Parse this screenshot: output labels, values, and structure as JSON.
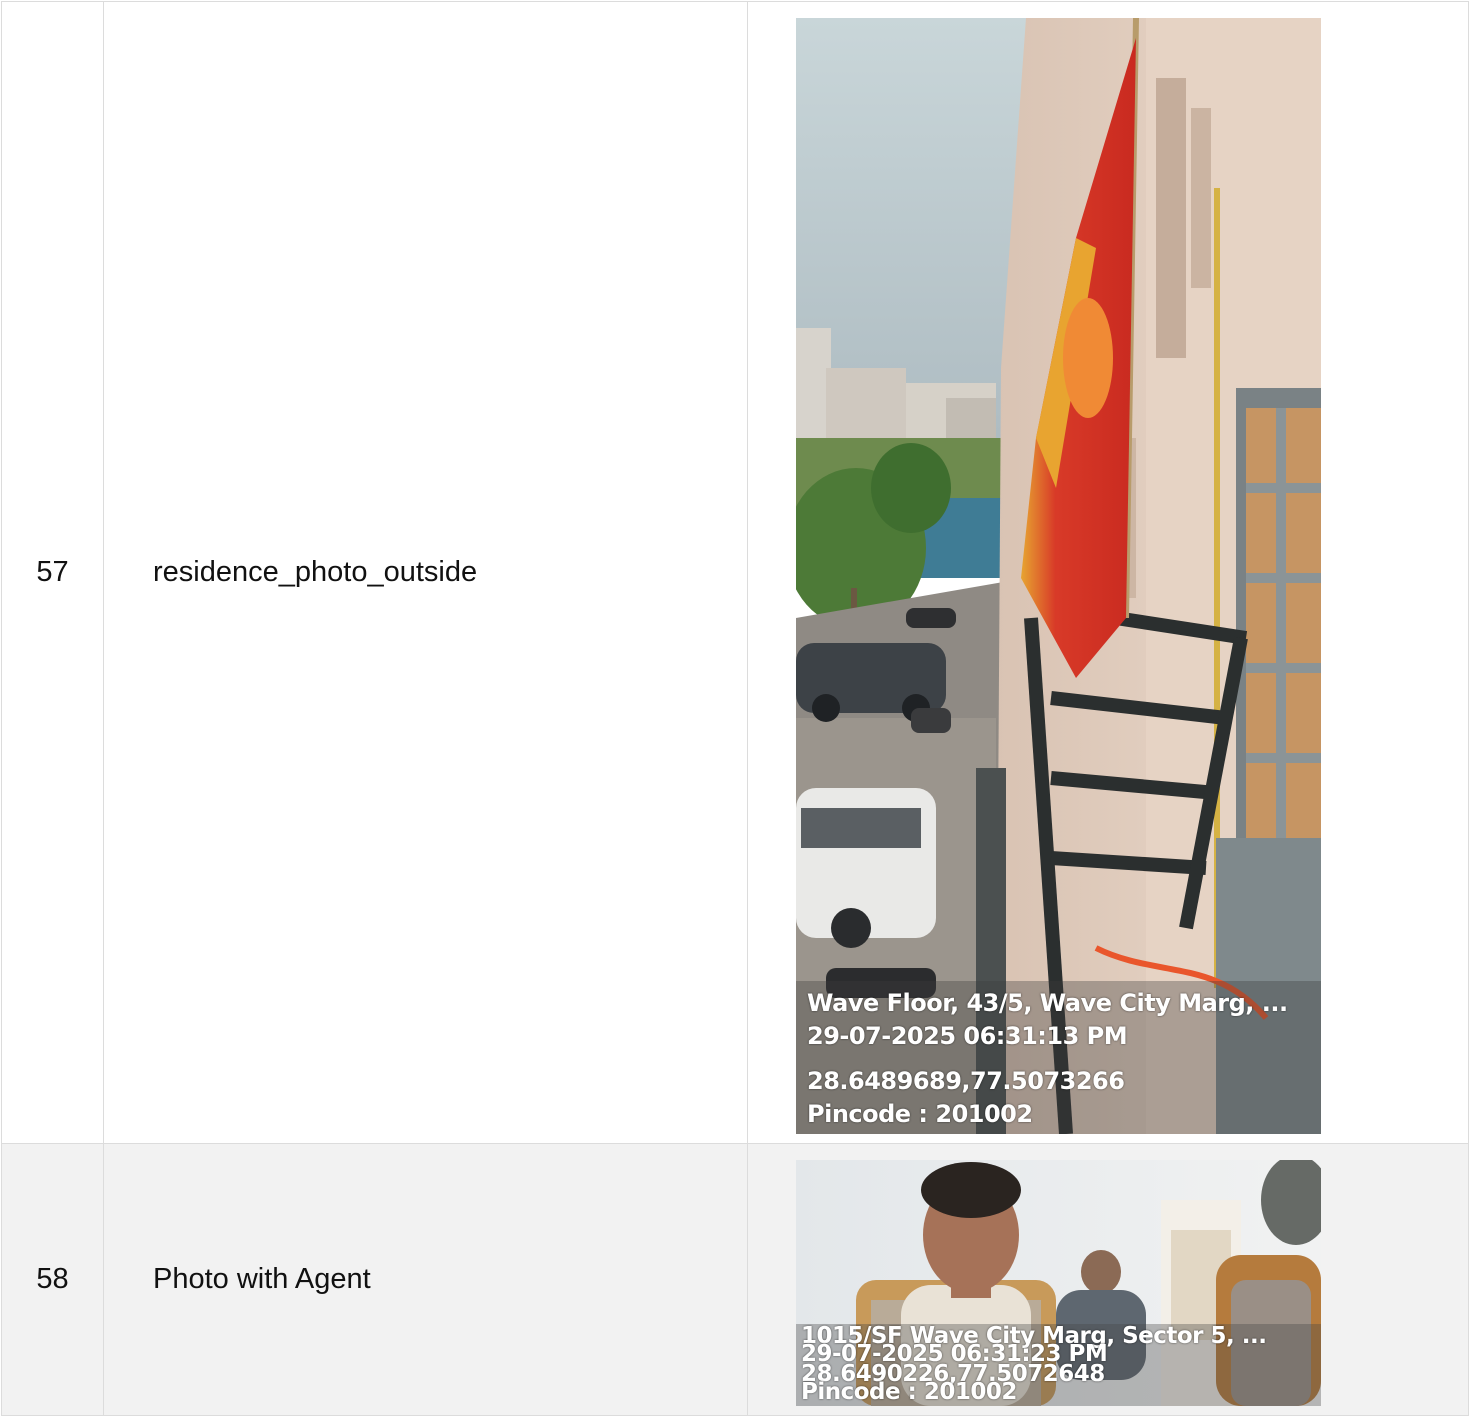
{
  "rows": [
    {
      "number": "57",
      "label": "residence_photo_outside",
      "photo": {
        "subject": "balcony view with flag, parked cars and buildings",
        "stamp": {
          "address": "Wave Floor, 43/5, Wave City Marg, ...",
          "datetime": "29-07-2025 06:31:13 PM",
          "coordinates": "28.6489689,77.5073266",
          "pincode": "Pincode : 201002"
        }
      }
    },
    {
      "number": "58",
      "label": "Photo with Agent",
      "photo": {
        "subject": "selfie with agent in living room",
        "stamp": {
          "address": "1015/SF Wave City Marg, Sector 5, ...",
          "datetime": "29-07-2025 06:31:23 PM",
          "coordinates": "28.6490226,77.5072648",
          "pincode": "Pincode : 201002"
        }
      }
    }
  ],
  "colors": {
    "border": "#dcdcdc",
    "alt_row_background": "#f2f2f2",
    "stamp_text": "#ffffff"
  }
}
